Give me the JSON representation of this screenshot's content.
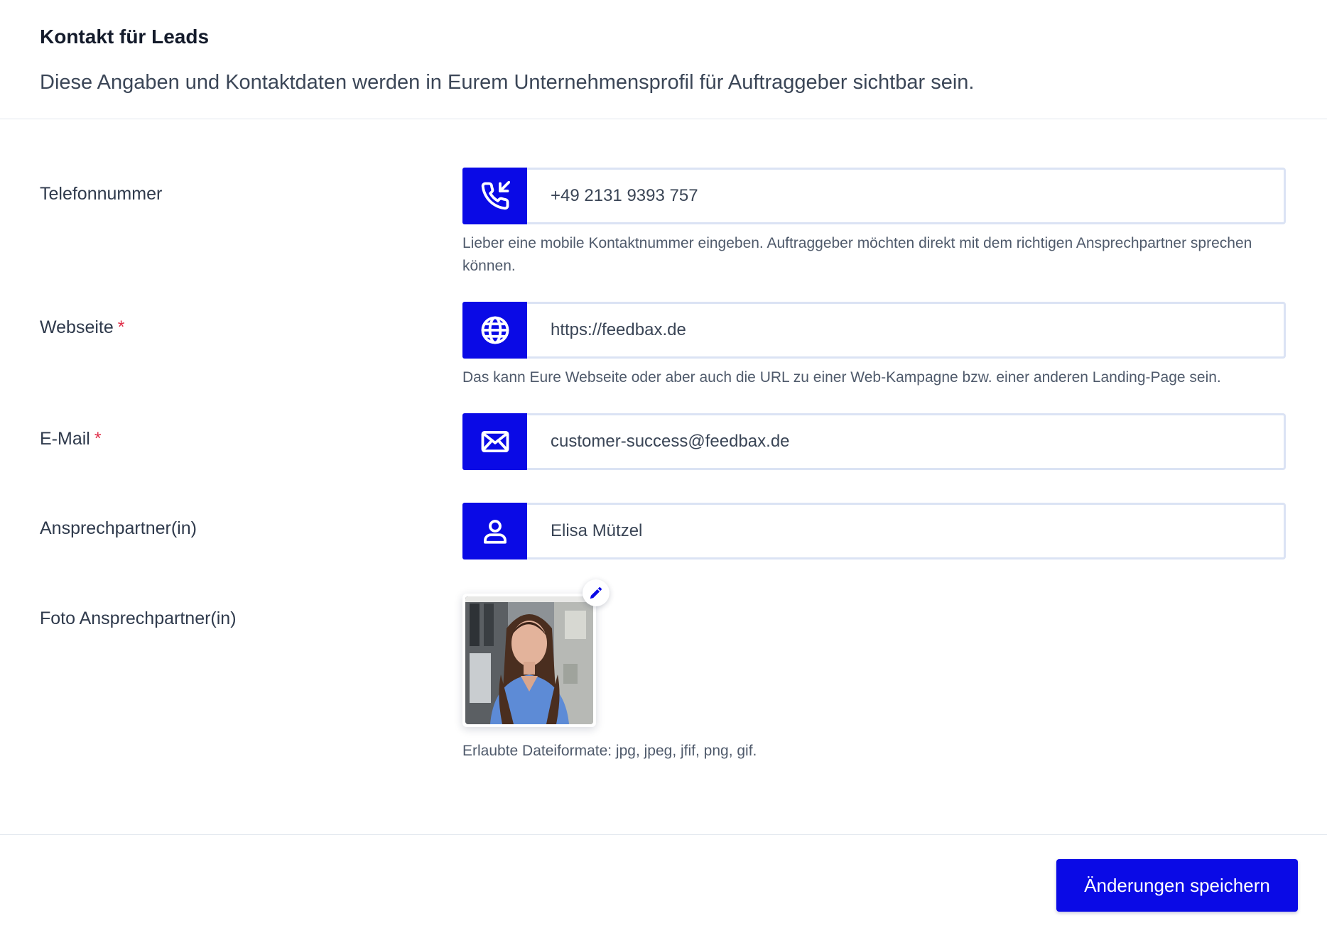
{
  "header": {
    "title": "Kontakt für Leads",
    "subtitle": "Diese Angaben und Kontaktdaten werden in Eurem Unternehmensprofil für Auftraggeber sichtbar sein."
  },
  "fields": {
    "phone": {
      "label": "Telefonnummer",
      "icon": "phone-incoming-icon",
      "value": "+49 2131 9393 757",
      "help": "Lieber eine mobile Kontaktnummer eingeben. Auftraggeber möchten direkt mit dem richtigen Ansprechpartner sprechen können."
    },
    "website": {
      "label": "Webseite",
      "required_mark": "*",
      "icon": "globe-icon",
      "value": "https://feedbax.de",
      "help": "Das kann Eure Webseite oder aber auch die URL zu einer Web-Kampagne bzw. einer anderen Landing-Page sein."
    },
    "email": {
      "label": "E-Mail",
      "required_mark": "*",
      "icon": "envelope-icon",
      "value": "customer-success@feedbax.de"
    },
    "contact_person": {
      "label": "Ansprechpartner(in)",
      "icon": "user-icon",
      "value": "Elisa Mützel"
    },
    "photo": {
      "label": "Foto Ansprechpartner(in)",
      "edit_icon": "pencil-icon",
      "help": "Erlaubte Dateiformate: jpg, jpeg, jfif, png, gif."
    }
  },
  "footer": {
    "save_label": "Änderungen speichern"
  },
  "colors": {
    "accent": "#0a0ae6",
    "required": "#e0314b",
    "input_border": "#dbe3f4",
    "divider": "#e3e8ef"
  }
}
